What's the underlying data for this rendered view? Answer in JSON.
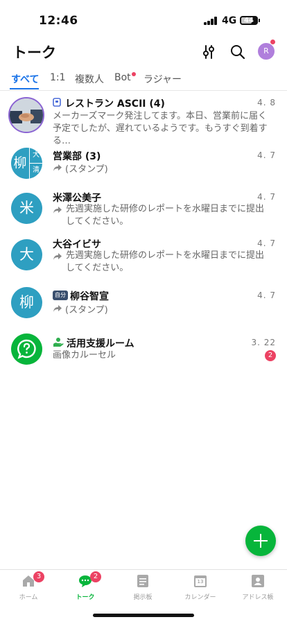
{
  "status_bar": {
    "time": "12:46",
    "network": "4G",
    "battery": "44"
  },
  "header": {
    "title": "トーク",
    "avatar_initial": "R"
  },
  "tabs": [
    {
      "label": "すべて",
      "active": true
    },
    {
      "label": "1:1"
    },
    {
      "label": "複数人"
    },
    {
      "label": "Bot"
    },
    {
      "label": "ラジャー"
    }
  ],
  "chats": [
    {
      "name": "レストラン ASCII (4)",
      "date": "4. 8",
      "preview": "メーカーズマーク発注してます。本日、営業前に届く予定でしたが、遅れているようです。もうすぐ到着する…"
    },
    {
      "name": "営業部 (3)",
      "date": "4. 7",
      "preview": "(スタンプ)",
      "avatar_chars": [
        "柳",
        "大",
        "清"
      ]
    },
    {
      "name": "米澤公美子",
      "date": "4. 7",
      "preview": "先週実施した研修のレポートを水曜日までに提出してください。",
      "avatar_char": "米"
    },
    {
      "name": "大谷イビサ",
      "date": "4. 7",
      "preview": "先週実施した研修のレポートを水曜日までに提出してください。",
      "avatar_char": "大"
    },
    {
      "name": "柳谷智宣",
      "date": "4. 7",
      "preview": "(スタンプ)",
      "avatar_char": "柳",
      "self_badge": "自分"
    },
    {
      "name": "活用支援ルーム",
      "date": "3. 22",
      "preview": "画像カルーセル",
      "unread": "2"
    }
  ],
  "bottom_nav": [
    {
      "label": "ホーム",
      "badge": "3",
      "icon": "home-icon"
    },
    {
      "label": "トーク",
      "badge": "2",
      "icon": "chat-bubble-icon",
      "active": true
    },
    {
      "label": "掲示板",
      "icon": "board-icon"
    },
    {
      "label": "カレンダー",
      "icon": "calendar-icon",
      "calendar_day": "13"
    },
    {
      "label": "アドレス帳",
      "icon": "address-book-icon"
    }
  ],
  "colors": {
    "accent_green": "#07b53b",
    "tab_blue": "#1a73e8",
    "badge_red": "#ec4263",
    "avatar_teal": "#2e9fc1"
  }
}
